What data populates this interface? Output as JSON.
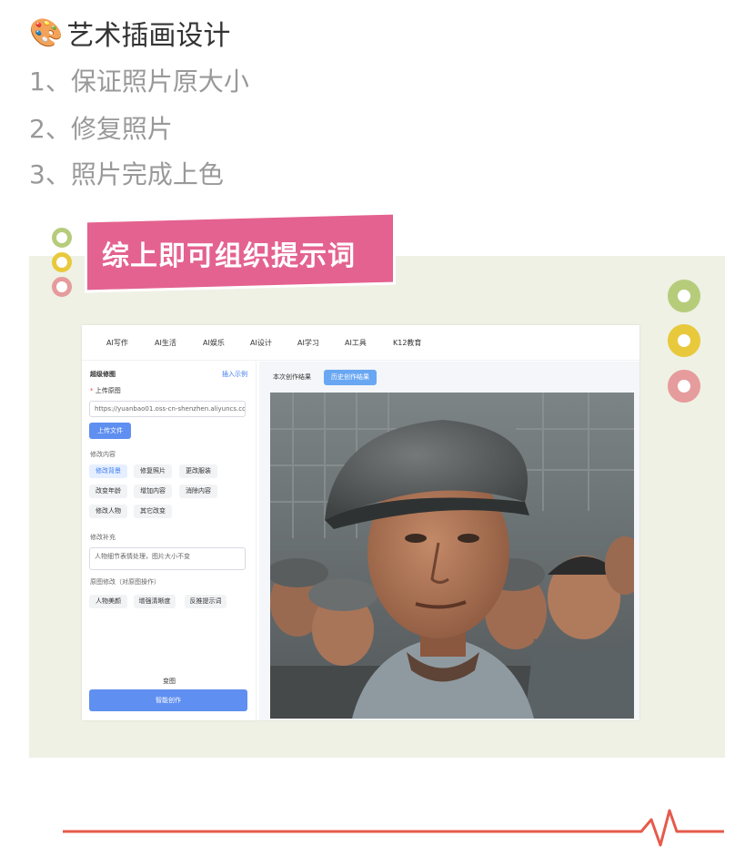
{
  "header": {
    "title": "艺术插画设计",
    "steps": [
      "1、保证照片原大小",
      "2、修复照片",
      "3、照片完成上色"
    ]
  },
  "banner": "综上即可组织提示词",
  "colors": {
    "panel": "#eef1e4",
    "banner": "#e4628f",
    "green": "#b6cc7b",
    "yellow": "#e9c93c",
    "pink": "#e69b9c",
    "accent": "#5f8ff0",
    "line": "#e65a4b"
  },
  "app": {
    "nav": [
      "AI写作",
      "AI生活",
      "AI娱乐",
      "AI设计",
      "AI学习",
      "AI工具",
      "K12教育"
    ],
    "left": {
      "title": "超级修图",
      "example_link": "插入示例",
      "upload_label": "上传原图",
      "url_value": "https://yuanbao01.oss-cn-shenzhen.aliyuncs.com/u",
      "upload_button": "上传文件",
      "modify_label": "修改内容",
      "chips": [
        "修改背景",
        "修复照片",
        "更改服装",
        "改变年龄",
        "增加内容",
        "消除内容",
        "修改人物",
        "其它改变"
      ],
      "supplement_label": "修改补充",
      "supplement_value": "人物细节表情处理，图片大小不变",
      "original_label": "原图修改（对原图操作）",
      "original_chips": [
        "人物美颜",
        "增强清晰度",
        "反推提示词"
      ],
      "change_label": "变图",
      "create_button": "智能创作"
    },
    "right": {
      "tabs": [
        "本次创作结果",
        "历史创作结果"
      ]
    }
  }
}
